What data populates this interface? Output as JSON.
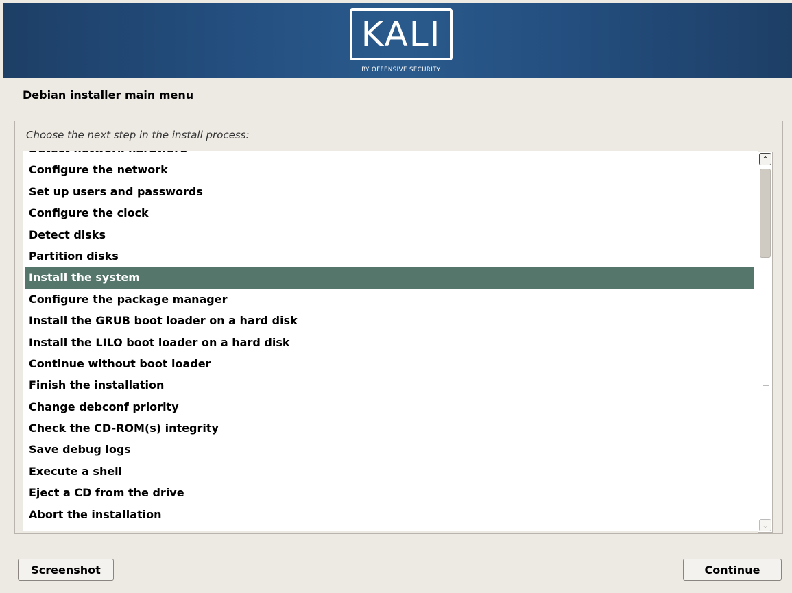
{
  "logo": {
    "main": "KALI",
    "sub": "BY OFFENSIVE SECURITY"
  },
  "page_title": "Debian installer main menu",
  "prompt": "Choose the next step in the install process:",
  "menu_items": [
    {
      "label": "Detect network hardware",
      "selected": false
    },
    {
      "label": "Configure the network",
      "selected": false
    },
    {
      "label": "Set up users and passwords",
      "selected": false
    },
    {
      "label": "Configure the clock",
      "selected": false
    },
    {
      "label": "Detect disks",
      "selected": false
    },
    {
      "label": "Partition disks",
      "selected": false
    },
    {
      "label": "Install the system",
      "selected": true
    },
    {
      "label": "Configure the package manager",
      "selected": false
    },
    {
      "label": "Install the GRUB boot loader on a hard disk",
      "selected": false
    },
    {
      "label": "Install the LILO boot loader on a hard disk",
      "selected": false
    },
    {
      "label": "Continue without boot loader",
      "selected": false
    },
    {
      "label": "Finish the installation",
      "selected": false
    },
    {
      "label": "Change debconf priority",
      "selected": false
    },
    {
      "label": "Check the CD-ROM(s) integrity",
      "selected": false
    },
    {
      "label": "Save debug logs",
      "selected": false
    },
    {
      "label": "Execute a shell",
      "selected": false
    },
    {
      "label": "Eject a CD from the drive",
      "selected": false
    },
    {
      "label": "Abort the installation",
      "selected": false
    }
  ],
  "buttons": {
    "screenshot": "Screenshot",
    "continue": "Continue"
  },
  "colors": {
    "banner": "#244f80",
    "selection": "#55776b",
    "background": "#ede9e3"
  },
  "icons": {
    "scroll_up": "chevron-up-icon",
    "scroll_down": "chevron-down-icon"
  }
}
